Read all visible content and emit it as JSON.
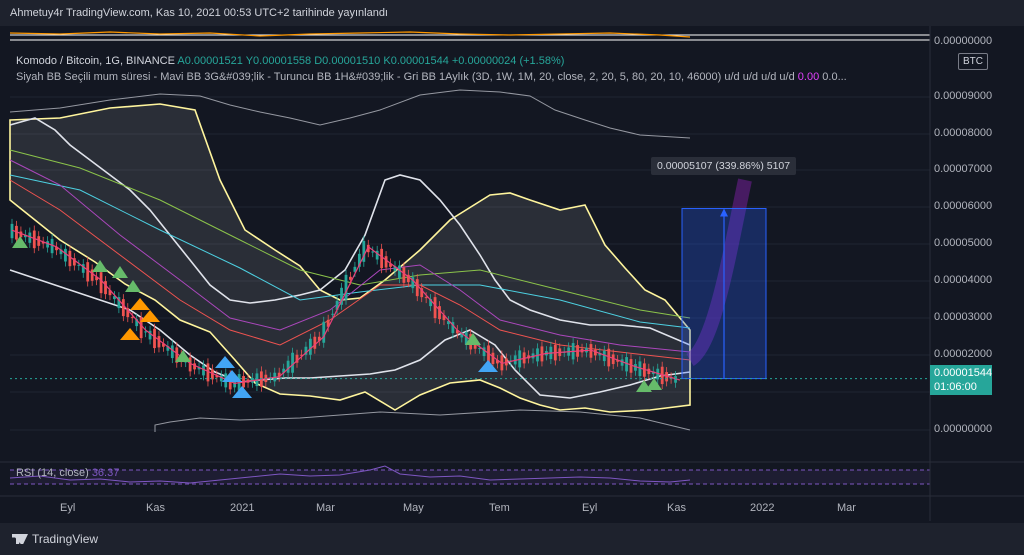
{
  "header": {
    "title": "Ahmetuy4r TradingView.com, Kas 10, 2021 00:53 UTC+2 tarihinde yayınlandı"
  },
  "legend": {
    "symbol": "Komodo / Bitcoin, 1G, BINANCE",
    "open": "A0.00001521",
    "high": "Y0.00001558",
    "low": "D0.00001510",
    "close": "K0.00001544",
    "change": "+0.00000024 (+1.58%)",
    "indicator": "Siyah BB Seçili mum süresi - Mavi BB 3G&#039;lik - Turuncu BB 1H&#039;lik - Gri BB 1Aylık (3D, 1W, 1M, 20, close, 2, 20, 5, 80, 20, 10, 46000)  u/d  u/d  u/d  u/d",
    "indicator_value": "0.00",
    "indicator_tail": "0.0..."
  },
  "price_axis": {
    "currency": "BTC",
    "ticks": [
      "0.00000000",
      "0.00010000",
      "0.00009000",
      "0.00008000",
      "0.00007000",
      "0.00006000",
      "0.00005000",
      "0.00004000",
      "0.00003000",
      "0.00002000",
      "0.00001000",
      "0.00000000"
    ]
  },
  "last_price": {
    "value": "0.00001544",
    "countdown": "01:06:00"
  },
  "measure": {
    "label": "0.00005107 (339.86%) 5107"
  },
  "rsi": {
    "label": "RSI (14, close)",
    "value": "36.37"
  },
  "time_axis": [
    "Eyl",
    "Kas",
    "2021",
    "Mar",
    "May",
    "Tem",
    "Eyl",
    "Kas",
    "2022",
    "Mar"
  ],
  "colors": {
    "background": "#131722",
    "up": "#26a69a",
    "down": "#ef5350",
    "bb_yellow": "#fff59d",
    "bb_white": "#ffffff",
    "bb_gray": "#9598a1",
    "measure": "#2962ff",
    "rsi": "#7e57c2"
  },
  "chart_data": {
    "type": "line",
    "title": "Komodo / Bitcoin, 1G, BINANCE",
    "xlabel": "",
    "ylabel": "",
    "ylim": [
      0,
      0.0001
    ],
    "x": [
      "2020-08",
      "2020-09",
      "2020-10",
      "2020-11",
      "2020-12",
      "2021-01",
      "2021-02",
      "2021-03",
      "2021-04",
      "2021-05",
      "2021-06",
      "2021-07",
      "2021-08",
      "2021-09",
      "2021-10",
      "2021-11"
    ],
    "series": [
      {
        "values": [
          6e-05,
          5.5e-05,
          4.5e-05,
          3e-05,
          2e-05,
          1.4e-05,
          1.6e-05,
          2.8e-05,
          5.5e-05,
          4.5e-05,
          3e-05,
          2e-05,
          2.3e-05,
          2.4e-05,
          1.9e-05,
          1.5e-05
        ]
      }
    ],
    "last": 1.544e-05,
    "measure_target": 6.651e-05
  }
}
